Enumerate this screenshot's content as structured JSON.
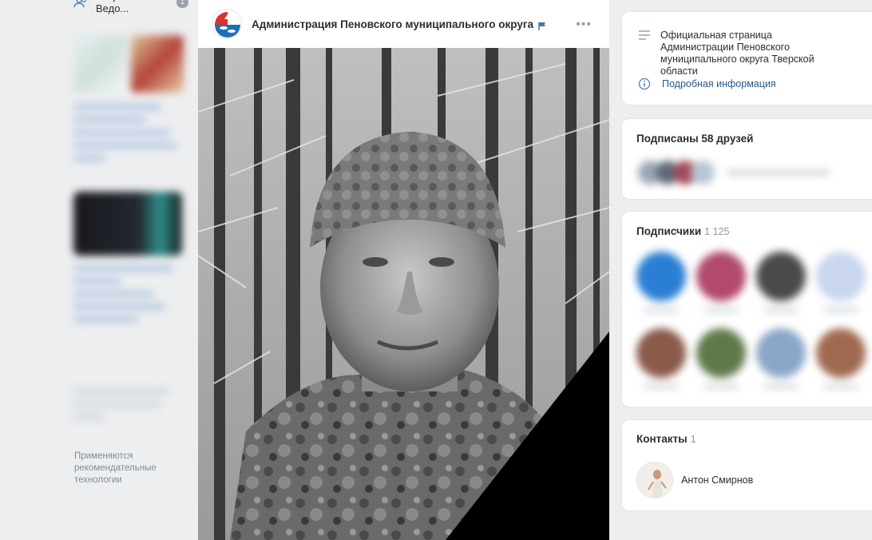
{
  "left": {
    "group_name": "Тверские Ведо...",
    "group_badge": "1",
    "recommend_text": "Применяются рекомендательные технологии"
  },
  "post": {
    "author": "Администрация Пеновского муниципального округа",
    "more_icon": "more-horizontal-icon",
    "flag_color": "#4a76a8",
    "photo_description_icon": "memorial-photo-black-ribbon"
  },
  "right": {
    "info": {
      "description": "Официальная страница Администрации Пеновского муниципального округа Тверской области",
      "more_link": "Подробная информация"
    },
    "friends": {
      "title": "Подписаны 58 друзей"
    },
    "subscribers": {
      "title": "Подписчики",
      "count": "1 125"
    },
    "contacts": {
      "title": "Контакты",
      "count": "1",
      "items": [
        {
          "name": "Антон Смирнов"
        }
      ]
    }
  },
  "colors": {
    "background": "#edeef0",
    "link": "#2a5885",
    "accent": "#5181b8"
  }
}
